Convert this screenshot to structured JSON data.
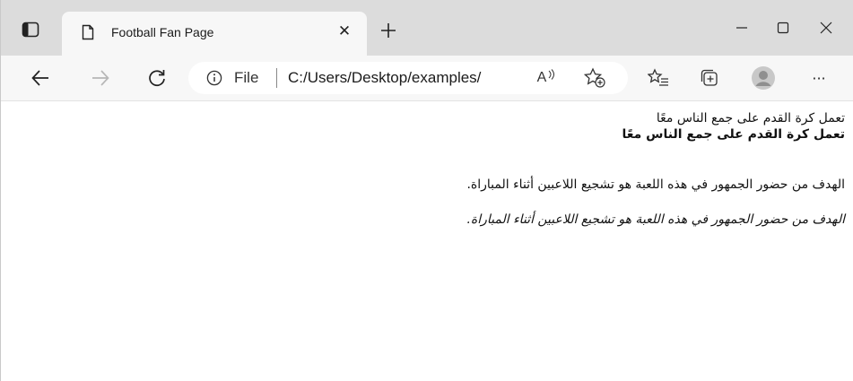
{
  "browser": {
    "tab": {
      "title": "Football Fan Page"
    },
    "address": {
      "scheme_label": "File",
      "url": "C:/Users/Desktop/examples/"
    },
    "read_aloud_label": "A",
    "more_label": "···"
  },
  "page": {
    "line1": "تعمل كرة القدم على جمع الناس معًا",
    "line2_bold": "تعمل كرة القدم على جمع الناس معًا",
    "line3": "الهدف من حضور الجمهور في هذه اللعبة هو تشجيع اللاعبين أثناء المباراة.",
    "line4_italic": "الهدف من حضور الجمهور في هذه اللعبة هو تشجيع اللاعبين أثناء المباراة."
  }
}
